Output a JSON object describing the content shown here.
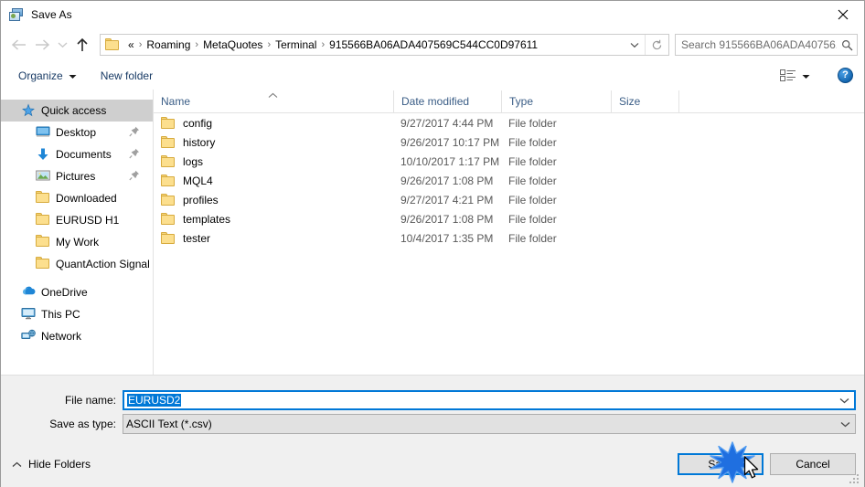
{
  "window": {
    "title": "Save As",
    "icon": "save-as-app-icon",
    "close_label": "✕"
  },
  "nav": {
    "back_icon": "arrow-left-icon",
    "forward_icon": "arrow-right-icon",
    "recent_icon": "chevron-down-icon",
    "up_icon": "arrow-up-icon",
    "breadcrumb": [
      "«",
      "Roaming",
      "MetaQuotes",
      "Terminal",
      "915566BA06ADA407569C544CC0D97611"
    ],
    "separator": "›",
    "address_dropdown_icon": "chevron-down-icon",
    "refresh_icon": "refresh-icon"
  },
  "search": {
    "placeholder": "Search 915566BA06ADA40756...",
    "icon": "search-icon"
  },
  "toolbar": {
    "organize_label": "Organize",
    "organize_caret": "▼",
    "new_folder_label": "New folder",
    "view_icon": "view-layout-icon",
    "view_caret": "▼",
    "help_label": "?",
    "help_icon": "help-icon"
  },
  "sidebar": {
    "items": [
      {
        "label": "Quick access",
        "icon": "star-pin-icon",
        "selected": true,
        "level": "root",
        "pinned": false
      },
      {
        "label": "Desktop",
        "icon": "desktop-icon",
        "selected": false,
        "level": "child",
        "pinned": true
      },
      {
        "label": "Documents",
        "icon": "documents-download-icon",
        "selected": false,
        "level": "child",
        "pinned": true
      },
      {
        "label": "Pictures",
        "icon": "pictures-icon",
        "selected": false,
        "level": "child",
        "pinned": true
      },
      {
        "label": "Downloaded",
        "icon": "folder-icon",
        "selected": false,
        "level": "child",
        "pinned": false
      },
      {
        "label": "EURUSD H1",
        "icon": "folder-icon",
        "selected": false,
        "level": "child",
        "pinned": false
      },
      {
        "label": "My Work",
        "icon": "folder-icon",
        "selected": false,
        "level": "child",
        "pinned": false
      },
      {
        "label": "QuantAction Signal",
        "icon": "folder-icon",
        "selected": false,
        "level": "child",
        "pinned": false
      },
      {
        "label": "OneDrive",
        "icon": "onedrive-cloud-icon",
        "selected": false,
        "level": "root",
        "pinned": false
      },
      {
        "label": "This PC",
        "icon": "this-pc-icon",
        "selected": false,
        "level": "root",
        "pinned": false
      },
      {
        "label": "Network",
        "icon": "network-icon",
        "selected": false,
        "level": "root",
        "pinned": false
      }
    ]
  },
  "filelist": {
    "columns": [
      "Name",
      "Date modified",
      "Type",
      "Size"
    ],
    "sort_column": "Name",
    "sort_caret": "⌃",
    "rows": [
      {
        "name": "config",
        "date": "9/27/2017 4:44 PM",
        "type": "File folder",
        "size": ""
      },
      {
        "name": "history",
        "date": "9/26/2017 10:17 PM",
        "type": "File folder",
        "size": ""
      },
      {
        "name": "logs",
        "date": "10/10/2017 1:17 PM",
        "type": "File folder",
        "size": ""
      },
      {
        "name": "MQL4",
        "date": "9/26/2017 1:08 PM",
        "type": "File folder",
        "size": ""
      },
      {
        "name": "profiles",
        "date": "9/27/2017 4:21 PM",
        "type": "File folder",
        "size": ""
      },
      {
        "name": "templates",
        "date": "9/26/2017 1:08 PM",
        "type": "File folder",
        "size": ""
      },
      {
        "name": "tester",
        "date": "10/4/2017 1:35 PM",
        "type": "File folder",
        "size": ""
      }
    ]
  },
  "form": {
    "filename_label": "File name:",
    "filename_value": "EURUSD2",
    "filename_dropdown_icon": "chevron-down-icon",
    "filetype_label": "Save as type:",
    "filetype_value": "ASCII Text (*.csv)",
    "filetype_dropdown_icon": "chevron-down-icon"
  },
  "footer": {
    "hide_folders_label": "Hide Folders",
    "hide_folders_caret": "⌃",
    "save_label": "Save",
    "cancel_label": "Cancel",
    "resize_grip_icon": "resize-grip-icon",
    "click_effect_icon": "click-starburst-icon",
    "cursor_icon": "mouse-pointer-icon"
  },
  "colors": {
    "accent": "#0078d7",
    "selection": "#0078d7",
    "sidebar_selected": "#cfcfcf",
    "chrome": "#f0f0f0",
    "folder": "#fcdf8e"
  }
}
